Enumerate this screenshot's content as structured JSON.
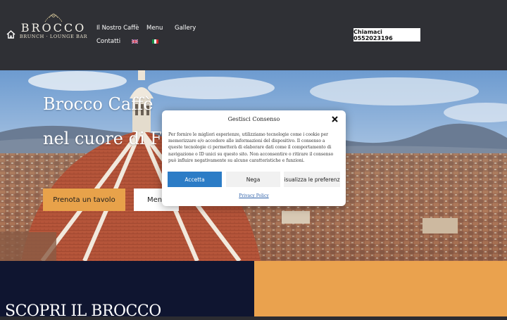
{
  "header": {
    "logo_word": "BROCCO",
    "logo_sub": "BRUNCH · LOUNGE BAR",
    "nav": [
      "Il Nostro Caffè",
      "Menu",
      "Gallery",
      "Contatti"
    ],
    "flags": [
      "uk-flag-icon",
      "italy-flag-icon"
    ],
    "call_button": "Chiamaci 0552023196"
  },
  "hero": {
    "title_line1": "Brocco Caffè",
    "title_line2": "nel cuore di Fi",
    "book_button": "Prenota un tavolo",
    "menu_button": "Menu"
  },
  "consent": {
    "title": "Gestisci Consenso",
    "text": "Per fornire le migliori esperienze, utilizziamo tecnologie come i cookie per memorizzare e/o accedere alle informazioni del dispositivo. Il consenso a queste tecnologie ci permetterà di elaborare dati come il comportamento di navigazione o ID unici su questo sito. Non acconsentire o ritirare il consenso può influire negativamente su alcune caratteristiche e funzioni.",
    "accept": "Accetta",
    "deny": "Nega",
    "preferences": "isualizza le preferenz",
    "privacy_link": "Privacy Policy"
  },
  "section": {
    "heading": "SCOPRI IL BROCCO"
  },
  "colors": {
    "header_bg": "#2f3035",
    "accent_orange": "#e8a24a",
    "accept_blue": "#2c7cc6",
    "dark_navy": "#0f1530"
  }
}
